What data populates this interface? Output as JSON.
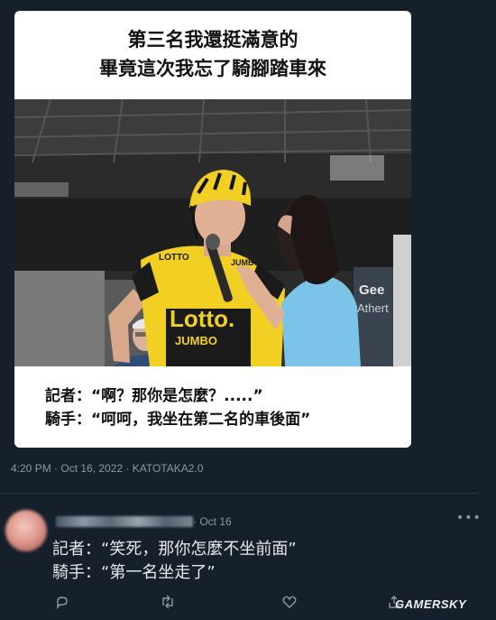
{
  "meme": {
    "caption_line1": "第三名我還挺滿意的",
    "caption_line2": "畢竟這次我忘了騎腳踏車來",
    "photo": {
      "helmet_text": "",
      "jersey_text1": "Lotto.",
      "jersey_text2": "JUMBO",
      "jersey_small1": "LOTTO",
      "jersey_small2": "JUMBO",
      "bg_sign1": "Gee",
      "bg_sign2": "Athert"
    },
    "dialog_line1": "記者：“啊？那你是怎麼？.....”",
    "dialog_line2": "騎手：“呵呵，我坐在第二名的車後面”"
  },
  "tweet": {
    "meta": "4:20 PM · Oct 16, 2022 · KATOTAKA2.0"
  },
  "reply": {
    "date": "· Oct 16",
    "more": "•••",
    "line1": "記者：“笑死，那你怎麼不坐前面”",
    "line2": "騎手：“第一名坐走了”"
  },
  "actions": [
    "reply-icon",
    "retweet-icon",
    "like-icon",
    "share-icon"
  ],
  "watermark": "GAMERSKY",
  "colors": {
    "background": "#15202b",
    "muted_text": "#8b98a5",
    "primary_text": "#e7e9ea",
    "jersey_yellow": "#f2d023",
    "reporter_blue": "#7cc3e8"
  }
}
